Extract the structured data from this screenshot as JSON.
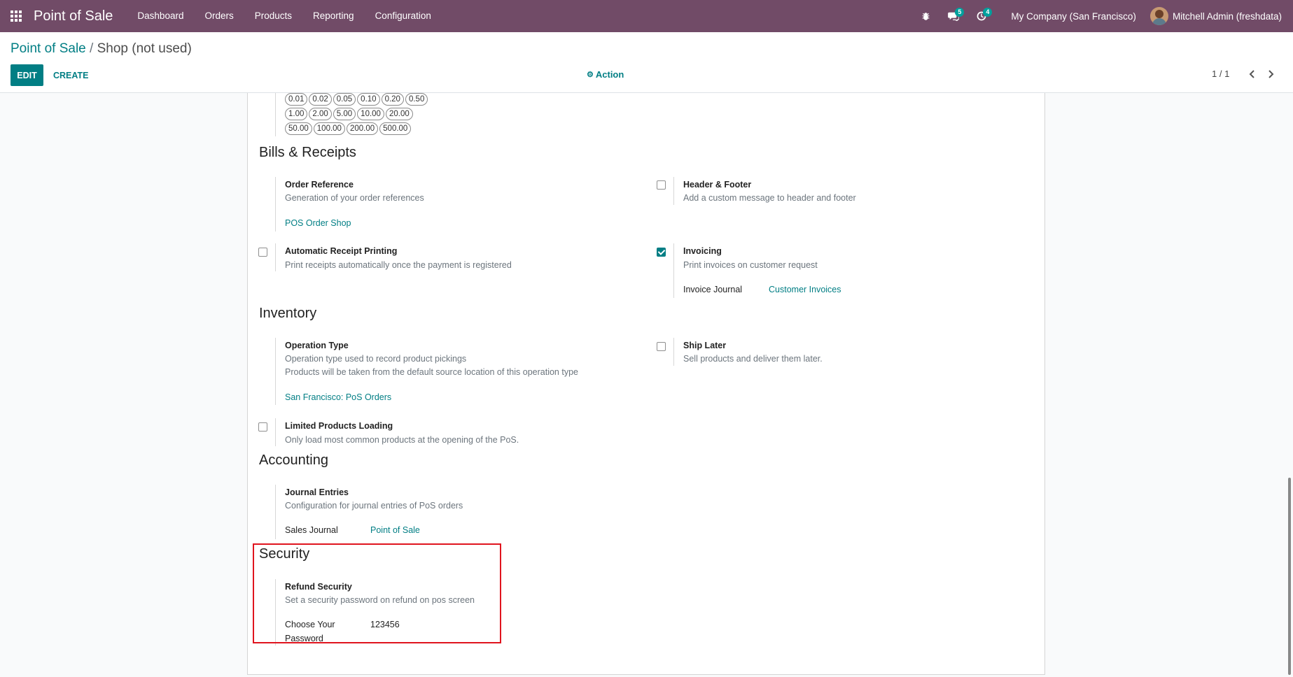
{
  "nav": {
    "app_title": "Point of Sale",
    "menu": [
      "Dashboard",
      "Orders",
      "Products",
      "Reporting",
      "Configuration"
    ],
    "messages_count": "5",
    "activities_count": "4",
    "company": "My Company (San Francisco)",
    "user": "Mitchell Admin (freshdata)"
  },
  "control": {
    "breadcrumb_root": "Point of Sale",
    "breadcrumb_sep": "/",
    "breadcrumb_current": "Shop (not used)",
    "edit_label": "EDIT",
    "create_label": "CREATE",
    "action_label": "Action",
    "pager": "1 / 1"
  },
  "coins": {
    "row1": [
      "0.01",
      "0.02",
      "0.05",
      "0.10",
      "0.20",
      "0.50"
    ],
    "row2": [
      "1.00",
      "2.00",
      "5.00",
      "10.00",
      "20.00"
    ],
    "row3": [
      "50.00",
      "100.00",
      "200.00",
      "500.00"
    ]
  },
  "bills": {
    "title": "Bills & Receipts",
    "order_ref_label": "Order Reference",
    "order_ref_desc": "Generation of your order references",
    "order_ref_value": "POS Order Shop",
    "header_footer_label": "Header & Footer",
    "header_footer_desc": "Add a custom message to header and footer",
    "auto_print_label": "Automatic Receipt Printing",
    "auto_print_desc": "Print receipts automatically once the payment is registered",
    "invoicing_label": "Invoicing",
    "invoicing_desc": "Print invoices on customer request",
    "invoice_journal_label": "Invoice Journal",
    "invoice_journal_value": "Customer Invoices"
  },
  "inventory": {
    "title": "Inventory",
    "op_type_label": "Operation Type",
    "op_type_desc1": "Operation type used to record product pickings",
    "op_type_desc2": "Products will be taken from the default source location of this operation type",
    "op_type_value": "San Francisco: PoS Orders",
    "ship_later_label": "Ship Later",
    "ship_later_desc": "Sell products and deliver them later.",
    "limited_label": "Limited Products Loading",
    "limited_desc": "Only load most common products at the opening of the PoS."
  },
  "accounting": {
    "title": "Accounting",
    "journal_label": "Journal Entries",
    "journal_desc": "Configuration for journal entries of PoS orders",
    "sales_journal_label": "Sales Journal",
    "sales_journal_value": "Point of Sale"
  },
  "security": {
    "title": "Security",
    "refund_label": "Refund Security",
    "refund_desc": "Set a security password on refund on pos screen",
    "password_label_1": "Choose Your",
    "password_label_2": "Password",
    "password_value": "123456"
  }
}
